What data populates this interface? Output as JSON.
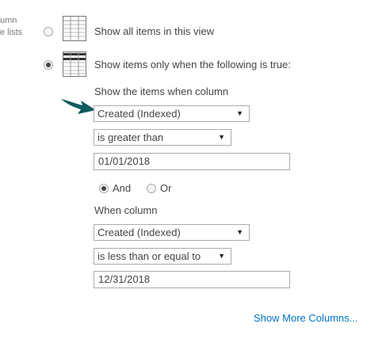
{
  "sidebar": {
    "text_line1": "umn",
    "text_line2": "e lists"
  },
  "filter": {
    "option_all_label": "Show all items in this view",
    "option_all_selected": false,
    "option_filtered_label": "Show items only when the following is true:",
    "option_filtered_selected": true,
    "condition1": {
      "heading": "Show the items when column",
      "column": "Created (Indexed)",
      "operator": "is greater than",
      "value": "01/01/2018"
    },
    "logic": {
      "and_label": "And",
      "or_label": "Or",
      "selected": "And"
    },
    "condition2": {
      "heading": "When column",
      "column": "Created (Indexed)",
      "operator": "is less than or equal to",
      "value": "12/31/2018"
    },
    "more_columns_link": "Show More Columns..."
  },
  "colors": {
    "arrow": "#0f5b5e",
    "link": "#0072c6"
  },
  "icons": {
    "all_items": "table-grid-icon",
    "filtered_items": "filtered-table-icon",
    "pointer": "arrow-pointer-icon",
    "dropdown": "caret-down-icon"
  }
}
